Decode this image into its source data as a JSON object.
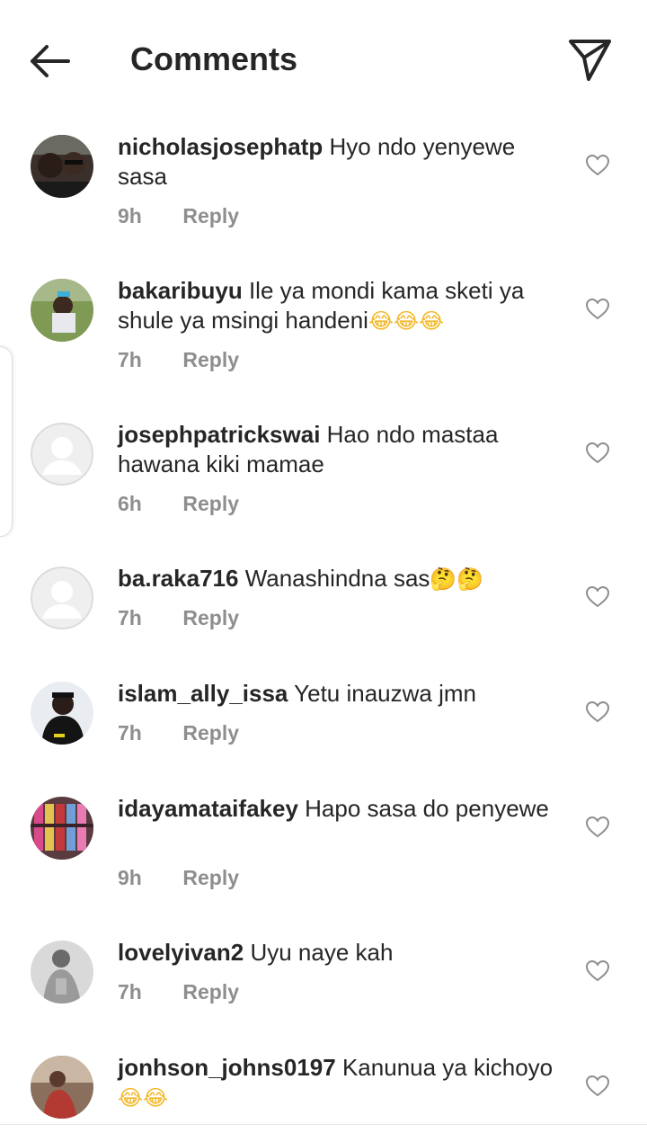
{
  "header": {
    "title": "Comments",
    "back_icon": "arrow-left-icon",
    "share_icon": "paper-plane-icon"
  },
  "comments": [
    {
      "username": "nicholasjosephatp",
      "text": "Hyo ndo yenyewe sasa",
      "emoji": "",
      "time": "9h",
      "reply": "Reply",
      "avatar": "photo"
    },
    {
      "username": "bakaribuyu",
      "text": "Ile  ya mondi kama sketi ya shule ya msingi handeni",
      "emoji": "😂😂😂",
      "time": "7h",
      "reply": "Reply",
      "avatar": "photo"
    },
    {
      "username": "josephpatrickswai",
      "text": "Hao ndo mastaa hawana kiki mamae",
      "emoji": "",
      "time": "6h",
      "reply": "Reply",
      "avatar": "default"
    },
    {
      "username": "ba.raka716",
      "text": "Wanashindna sas",
      "emoji": "🤔🤔",
      "time": "7h",
      "reply": "Reply",
      "avatar": "default"
    },
    {
      "username": "islam_ally_issa",
      "text": "Yetu inauzwa jmn",
      "emoji": "",
      "time": "7h",
      "reply": "Reply",
      "avatar": "photo"
    },
    {
      "username": "idayamataifakey",
      "text": "Hapo sasa do penyewe",
      "emoji": "",
      "time": "9h",
      "reply": "Reply",
      "avatar": "photo"
    },
    {
      "username": "lovelyivan2",
      "text": "Uyu naye kah",
      "emoji": "",
      "time": "7h",
      "reply": "Reply",
      "avatar": "photo"
    },
    {
      "username": "jonhson_johns0197",
      "text": "Kanunua ya kichoyo ",
      "emoji": "😂😂",
      "time": "",
      "reply": "",
      "avatar": "photo"
    }
  ],
  "colors": {
    "text": "#262626",
    "meta": "#8e8e8e",
    "icon": "#262626",
    "heart": "#8e8e8e",
    "default_avatar_bg": "#efefef",
    "default_avatar_fg": "#ffffff"
  }
}
